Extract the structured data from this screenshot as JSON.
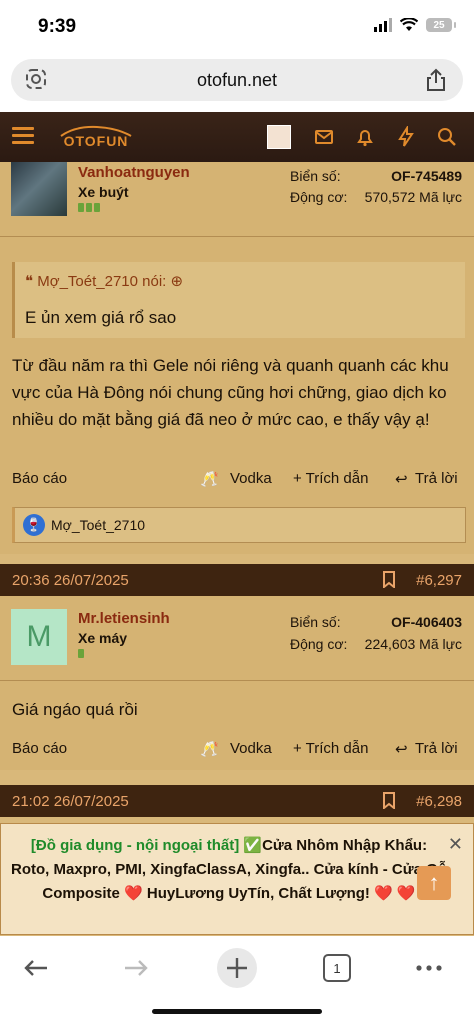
{
  "status_bar": {
    "time": "9:39",
    "battery": "25"
  },
  "browser": {
    "domain": "otofun.net",
    "tab_count": "1"
  },
  "site": {
    "logo_text": "OTOFUN"
  },
  "post1": {
    "username": "Vanhoatnguyen",
    "user_title": "Xe buýt",
    "plate_label": "Biển số:",
    "plate_value": "OF-745489",
    "engine_label": "Động cơ:",
    "engine_value": "570,572 Mã lực",
    "quote_author": "Mợ_Toét_2710 nói:",
    "quote_text": "E ủn xem giá rổ sao",
    "body": "Từ đầu năm ra thì Gele nói riêng và quanh quanh các khu vực của Hà Đông nói chung cũng hơi chững, giao dịch ko nhiều do mặt bằng giá đã neo ở mức cao, e thấy vậy ạ!",
    "report": "Báo cáo",
    "vodka": "Vodka",
    "quote_btn": "+ Trích dẫn",
    "reply": "Trả lời",
    "reaction_user": "Mợ_Toét_2710"
  },
  "post2": {
    "datetime": "20:36 26/07/2025",
    "number": "#6,297",
    "avatar_letter": "M",
    "username": "Mr.letiensinh",
    "user_title": "Xe máy",
    "plate_label": "Biển số:",
    "plate_value": "OF-406403",
    "engine_label": "Động cơ:",
    "engine_value": "224,603 Mã lực",
    "body": "Giá ngáo quá rồi",
    "report": "Báo cáo",
    "vodka": "Vodka",
    "quote_btn": "+ Trích dẫn",
    "reply": "Trả lời"
  },
  "post3": {
    "datetime": "21:02 26/07/2025",
    "number": "#6,298"
  },
  "ad": {
    "category": "[Đồ gia dụng - nội ngoại thất]",
    "text": "Cửa Nhôm Nhập Khẩu: Roto, Maxpro, PMI, XingfaClassA, Xingfa.. Cửa kính - Cửa Gỗ Composite ❤️ HuyLương UyTín, Chất Lượng! ❤️ ❤️",
    "close": "✕"
  },
  "colors": {
    "header_bg": "#2b1a12",
    "post_bg": "#d5b373",
    "date_bar": "#3e2410",
    "accent": "#e08a2c"
  }
}
